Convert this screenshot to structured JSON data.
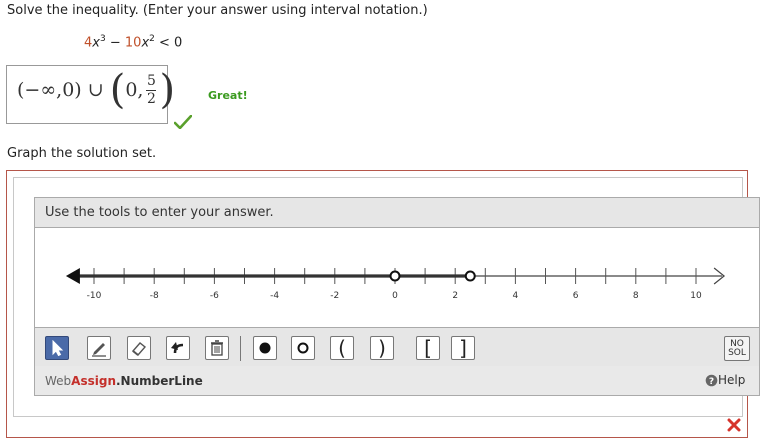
{
  "question": {
    "prompt": "Solve the inequality. (Enter your answer using interval notation.)",
    "inequality": {
      "coef1": "4",
      "var1": "x",
      "exp1": "3",
      "op": " − ",
      "coef2": "10",
      "var2": "x",
      "exp2": "2",
      "relation": " < 0"
    }
  },
  "answer": {
    "part1": "(−∞,0) ∪ ",
    "part2_start": "0,",
    "frac_num": "5",
    "frac_den": "2",
    "feedback": "Great!",
    "status": "correct"
  },
  "graph": {
    "prompt": "Graph the solution set.",
    "instructions": "Use the tools to enter your answer.",
    "axis": {
      "min": -11,
      "max": 11,
      "tick_step": 1,
      "labels": [
        "-10",
        "-8",
        "-6",
        "-4",
        "-2",
        "0",
        "2",
        "4",
        "6",
        "8",
        "10"
      ]
    },
    "solution": {
      "ray": {
        "from": "left-infinity",
        "to": 0
      },
      "segment": {
        "from": 0,
        "to": 2.5
      },
      "open_points": [
        0,
        2.5
      ]
    },
    "tools": [
      {
        "name": "pointer-tool",
        "label": "",
        "selected": true
      },
      {
        "name": "pencil-tool",
        "label": ""
      },
      {
        "name": "eraser-tool",
        "label": ""
      },
      {
        "name": "undo-tool",
        "label": ""
      },
      {
        "name": "delete-tool",
        "label": ""
      },
      {
        "name": "closed-point-tool",
        "label": ""
      },
      {
        "name": "open-point-tool",
        "label": ""
      },
      {
        "name": "left-paren-tool",
        "label": "("
      },
      {
        "name": "right-paren-tool",
        "label": ")"
      },
      {
        "name": "left-bracket-tool",
        "label": "["
      },
      {
        "name": "right-bracket-tool",
        "label": "]"
      }
    ],
    "no_solution_label": [
      "NO",
      "SOL"
    ],
    "brand": {
      "web": "Web",
      "assign": "Assign",
      "rest": ".NumberLine"
    },
    "help": "Help",
    "result": "incorrect"
  },
  "colors": {
    "correct": "#3a9a1f",
    "incorrect": "#d6342c",
    "accent": "#c0502a",
    "frame": "#b5564a",
    "tool_selected": "#4a6aa8"
  }
}
